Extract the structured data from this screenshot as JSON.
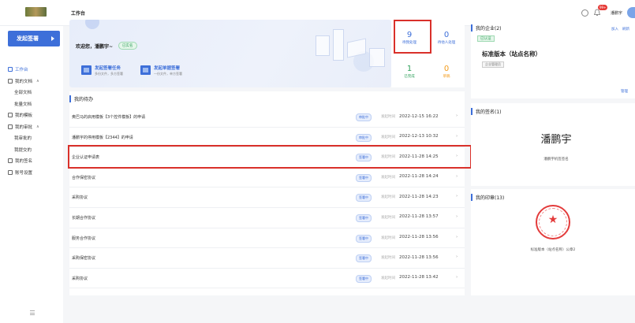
{
  "topbar": {
    "title": "工作台",
    "badge": "99+",
    "user_name": "潘鹏宇"
  },
  "sidebar": {
    "launch_label": "发起签署",
    "items": [
      {
        "label": "工作台",
        "active": true,
        "sub": false
      },
      {
        "label": "我的文档",
        "active": false,
        "sub": false,
        "expandable": true
      },
      {
        "label": "全部文档",
        "active": false,
        "sub": true
      },
      {
        "label": "批量文档",
        "active": false,
        "sub": true
      },
      {
        "label": "我的模板",
        "active": false,
        "sub": false
      },
      {
        "label": "我的审批",
        "active": false,
        "sub": false,
        "expandable": true
      },
      {
        "label": "我审批的",
        "active": false,
        "sub": true
      },
      {
        "label": "我提交的",
        "active": false,
        "sub": true
      },
      {
        "label": "我的签名",
        "active": false,
        "sub": false
      },
      {
        "label": "账号设置",
        "active": false,
        "sub": false
      }
    ]
  },
  "welcome": {
    "greeting": "欢迎您，潘鹏宇~",
    "verified": "已实名",
    "actions": [
      {
        "title": "发起签署任务",
        "subtitle": "多份文件，多方签署"
      },
      {
        "title": "发起单据签署",
        "subtitle": "一份文件，单方签署"
      }
    ]
  },
  "stats": [
    {
      "value": "9",
      "label": "待我处理",
      "color": "#3d6fd9"
    },
    {
      "value": "0",
      "label": "待他人处理",
      "color": "#3d6fd9"
    },
    {
      "value": "1",
      "label": "已完成",
      "color": "#2ea05a"
    },
    {
      "value": "0",
      "label": "草稿",
      "color": "#f39b1a"
    }
  ],
  "todo": {
    "title": "我的待办",
    "time_label": "发起时间",
    "rows": [
      {
        "name": "奥巴马的启用模板【3个控件模板】的申请",
        "status": "审批中",
        "time": "2022-12-15 16:22"
      },
      {
        "name": "潘鹏宇的停用模板【2344】的申请",
        "status": "审批中",
        "time": "2022-12-13 10:32"
      },
      {
        "name": "企业认证申请表",
        "status": "签署中",
        "time": "2022-11-28 14:25"
      },
      {
        "name": "合作保密协议",
        "status": "签署中",
        "time": "2022-11-28 14:24"
      },
      {
        "name": "采购协议",
        "status": "签署中",
        "time": "2022-11-28 14:23"
      },
      {
        "name": "长期合作协议",
        "status": "签署中",
        "time": "2022-11-28 13:57"
      },
      {
        "name": "服务合作协议",
        "status": "签署中",
        "time": "2022-11-28 13:56"
      },
      {
        "name": "采购保密协议",
        "status": "签署中",
        "time": "2022-11-28 13:56"
      },
      {
        "name": "采购协议",
        "status": "签署中",
        "time": "2022-11-28 13:42"
      }
    ]
  },
  "my_company": {
    "title": "我的企业(2)",
    "links": [
      "加入",
      "刷新"
    ],
    "auth_tag": "已认证",
    "org_name": "标准版本（站点名称）",
    "org_tag": "企业管理员",
    "manage": "管理"
  },
  "my_signature": {
    "title": "我的签名(1)",
    "signature_text": "潘鹏宇",
    "caption": "潘鹏宇机签签名"
  },
  "my_seal": {
    "title": "我的印章(13)",
    "caption": "标准版本（站点名称）公章2"
  }
}
